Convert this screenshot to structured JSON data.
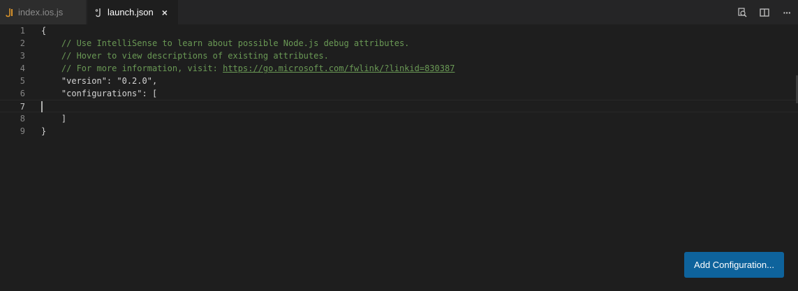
{
  "tabs": [
    {
      "label": "index.ios.js",
      "icon": "js-file-icon",
      "active": false
    },
    {
      "label": "launch.json",
      "icon": "json-file-icon",
      "active": true,
      "close": "×"
    }
  ],
  "actions": [
    {
      "icon": "open-changes-icon"
    },
    {
      "icon": "split-editor-icon"
    },
    {
      "icon": "more-actions-icon",
      "glyph": "···"
    }
  ],
  "editor": {
    "lines": [
      {
        "num": "1",
        "text": "{"
      },
      {
        "num": "2",
        "comment": "    // Use IntelliSense to learn about possible Node.js debug attributes."
      },
      {
        "num": "3",
        "comment": "    // Hover to view descriptions of existing attributes."
      },
      {
        "num": "4",
        "comment": "    // For more information, visit: ",
        "link": "https://go.microsoft.com/fwlink/?linkid=830387"
      },
      {
        "num": "5",
        "text": "    \"version\": \"0.2.0\","
      },
      {
        "num": "6",
        "text": "    \"configurations\": ["
      },
      {
        "num": "7",
        "text": ""
      },
      {
        "num": "8",
        "text": "    ]"
      },
      {
        "num": "9",
        "text": "}"
      }
    ]
  },
  "button": {
    "add_configuration": "Add Configuration..."
  },
  "colors": {
    "background": "#1e1e1e",
    "tabbar": "#252526",
    "comment": "#6a9955",
    "button": "#0e639c",
    "js_icon": "#d7922b"
  }
}
